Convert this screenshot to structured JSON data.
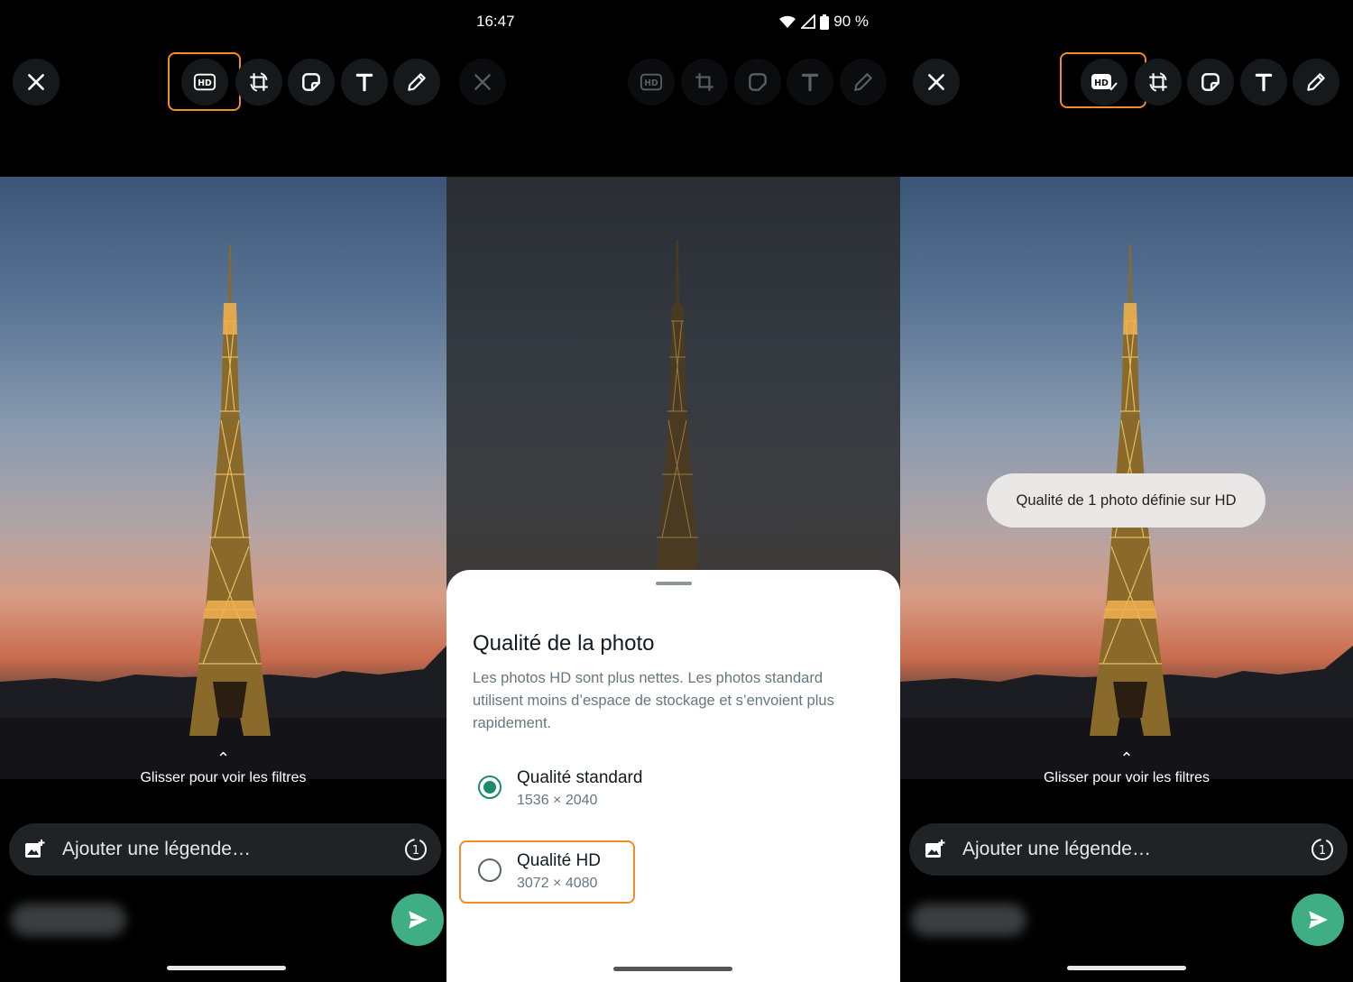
{
  "status_bar": {
    "time": "16:47",
    "battery": "90 %"
  },
  "left": {
    "filters_hint": "Glisser pour voir les filtres",
    "caption_placeholder": "Ajouter une légende…"
  },
  "center": {
    "sheet": {
      "title": "Qualité de la photo",
      "description": "Les photos HD sont plus nettes. Les photos standard utilisent moins d’espace de stockage et s’envoient plus rapidement.",
      "options": [
        {
          "label": "Qualité standard",
          "size": "1536 × 2040",
          "selected": true
        },
        {
          "label": "Qualité HD",
          "size": "3072 × 4080",
          "selected": false
        }
      ]
    }
  },
  "right": {
    "toast": "Qualité de 1 photo définie sur HD",
    "filters_hint": "Glisser pour voir les filtres",
    "caption_placeholder": "Ajouter une légende…"
  },
  "colors": {
    "highlight": "#f28c28",
    "send": "#3fae84",
    "radio_on": "#1c8a6b"
  },
  "icons": [
    "close-icon",
    "hd-icon",
    "crop-rotate-icon",
    "sticker-icon",
    "text-icon",
    "pencil-icon",
    "add-image-icon",
    "view-once-icon",
    "send-icon",
    "wifi-icon",
    "signal-icon",
    "battery-icon"
  ]
}
